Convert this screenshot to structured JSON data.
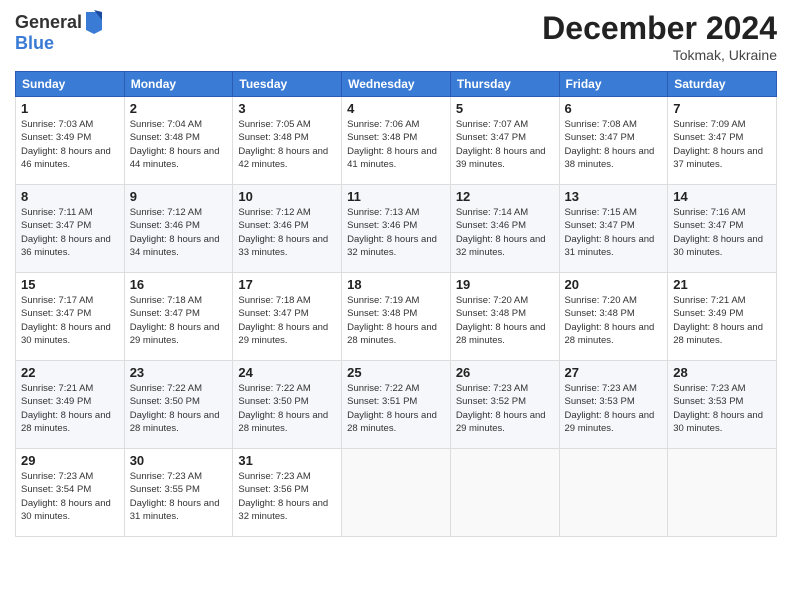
{
  "header": {
    "logo_line1": "General",
    "logo_line2": "Blue",
    "month_title": "December 2024",
    "location": "Tokmak, Ukraine"
  },
  "weekdays": [
    "Sunday",
    "Monday",
    "Tuesday",
    "Wednesday",
    "Thursday",
    "Friday",
    "Saturday"
  ],
  "weeks": [
    [
      {
        "day": "1",
        "sunrise": "7:03 AM",
        "sunset": "3:49 PM",
        "daylight": "8 hours and 46 minutes."
      },
      {
        "day": "2",
        "sunrise": "7:04 AM",
        "sunset": "3:48 PM",
        "daylight": "8 hours and 44 minutes."
      },
      {
        "day": "3",
        "sunrise": "7:05 AM",
        "sunset": "3:48 PM",
        "daylight": "8 hours and 42 minutes."
      },
      {
        "day": "4",
        "sunrise": "7:06 AM",
        "sunset": "3:48 PM",
        "daylight": "8 hours and 41 minutes."
      },
      {
        "day": "5",
        "sunrise": "7:07 AM",
        "sunset": "3:47 PM",
        "daylight": "8 hours and 39 minutes."
      },
      {
        "day": "6",
        "sunrise": "7:08 AM",
        "sunset": "3:47 PM",
        "daylight": "8 hours and 38 minutes."
      },
      {
        "day": "7",
        "sunrise": "7:09 AM",
        "sunset": "3:47 PM",
        "daylight": "8 hours and 37 minutes."
      }
    ],
    [
      {
        "day": "8",
        "sunrise": "7:11 AM",
        "sunset": "3:47 PM",
        "daylight": "8 hours and 36 minutes."
      },
      {
        "day": "9",
        "sunrise": "7:12 AM",
        "sunset": "3:46 PM",
        "daylight": "8 hours and 34 minutes."
      },
      {
        "day": "10",
        "sunrise": "7:12 AM",
        "sunset": "3:46 PM",
        "daylight": "8 hours and 33 minutes."
      },
      {
        "day": "11",
        "sunrise": "7:13 AM",
        "sunset": "3:46 PM",
        "daylight": "8 hours and 32 minutes."
      },
      {
        "day": "12",
        "sunrise": "7:14 AM",
        "sunset": "3:46 PM",
        "daylight": "8 hours and 32 minutes."
      },
      {
        "day": "13",
        "sunrise": "7:15 AM",
        "sunset": "3:47 PM",
        "daylight": "8 hours and 31 minutes."
      },
      {
        "day": "14",
        "sunrise": "7:16 AM",
        "sunset": "3:47 PM",
        "daylight": "8 hours and 30 minutes."
      }
    ],
    [
      {
        "day": "15",
        "sunrise": "7:17 AM",
        "sunset": "3:47 PM",
        "daylight": "8 hours and 30 minutes."
      },
      {
        "day": "16",
        "sunrise": "7:18 AM",
        "sunset": "3:47 PM",
        "daylight": "8 hours and 29 minutes."
      },
      {
        "day": "17",
        "sunrise": "7:18 AM",
        "sunset": "3:47 PM",
        "daylight": "8 hours and 29 minutes."
      },
      {
        "day": "18",
        "sunrise": "7:19 AM",
        "sunset": "3:48 PM",
        "daylight": "8 hours and 28 minutes."
      },
      {
        "day": "19",
        "sunrise": "7:20 AM",
        "sunset": "3:48 PM",
        "daylight": "8 hours and 28 minutes."
      },
      {
        "day": "20",
        "sunrise": "7:20 AM",
        "sunset": "3:48 PM",
        "daylight": "8 hours and 28 minutes."
      },
      {
        "day": "21",
        "sunrise": "7:21 AM",
        "sunset": "3:49 PM",
        "daylight": "8 hours and 28 minutes."
      }
    ],
    [
      {
        "day": "22",
        "sunrise": "7:21 AM",
        "sunset": "3:49 PM",
        "daylight": "8 hours and 28 minutes."
      },
      {
        "day": "23",
        "sunrise": "7:22 AM",
        "sunset": "3:50 PM",
        "daylight": "8 hours and 28 minutes."
      },
      {
        "day": "24",
        "sunrise": "7:22 AM",
        "sunset": "3:50 PM",
        "daylight": "8 hours and 28 minutes."
      },
      {
        "day": "25",
        "sunrise": "7:22 AM",
        "sunset": "3:51 PM",
        "daylight": "8 hours and 28 minutes."
      },
      {
        "day": "26",
        "sunrise": "7:23 AM",
        "sunset": "3:52 PM",
        "daylight": "8 hours and 29 minutes."
      },
      {
        "day": "27",
        "sunrise": "7:23 AM",
        "sunset": "3:53 PM",
        "daylight": "8 hours and 29 minutes."
      },
      {
        "day": "28",
        "sunrise": "7:23 AM",
        "sunset": "3:53 PM",
        "daylight": "8 hours and 30 minutes."
      }
    ],
    [
      {
        "day": "29",
        "sunrise": "7:23 AM",
        "sunset": "3:54 PM",
        "daylight": "8 hours and 30 minutes."
      },
      {
        "day": "30",
        "sunrise": "7:23 AM",
        "sunset": "3:55 PM",
        "daylight": "8 hours and 31 minutes."
      },
      {
        "day": "31",
        "sunrise": "7:23 AM",
        "sunset": "3:56 PM",
        "daylight": "8 hours and 32 minutes."
      },
      null,
      null,
      null,
      null
    ]
  ]
}
